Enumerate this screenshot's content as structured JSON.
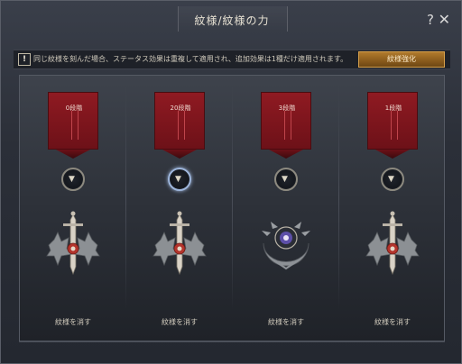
{
  "window": {
    "title": "紋様/紋様の力",
    "help_label": "?",
    "close_label": "✕"
  },
  "info": {
    "warning_mark": "!",
    "text": "同じ紋様を刻んだ場合、ステータス効果は重複して適用され、追加効果は1種だけ適用されます。",
    "enhance_label": "紋様強化"
  },
  "slots": [
    {
      "grade": "0段階",
      "emblem": "sword-shield-emblem",
      "selected": false,
      "remove_label": "紋様を消す"
    },
    {
      "grade": "20段階",
      "emblem": "sword-shield-emblem",
      "selected": true,
      "remove_label": "紋様を消す"
    },
    {
      "grade": "3段階",
      "emblem": "eye-crescent-emblem",
      "selected": false,
      "remove_label": "紋様を消す"
    },
    {
      "grade": "1段階",
      "emblem": "sword-shield-emblem",
      "selected": false,
      "remove_label": "紋様を消す"
    }
  ],
  "colors": {
    "banner": "#8f1a22",
    "enhance_button": "#a06c26",
    "selected_ring": "#9fb7dd"
  }
}
